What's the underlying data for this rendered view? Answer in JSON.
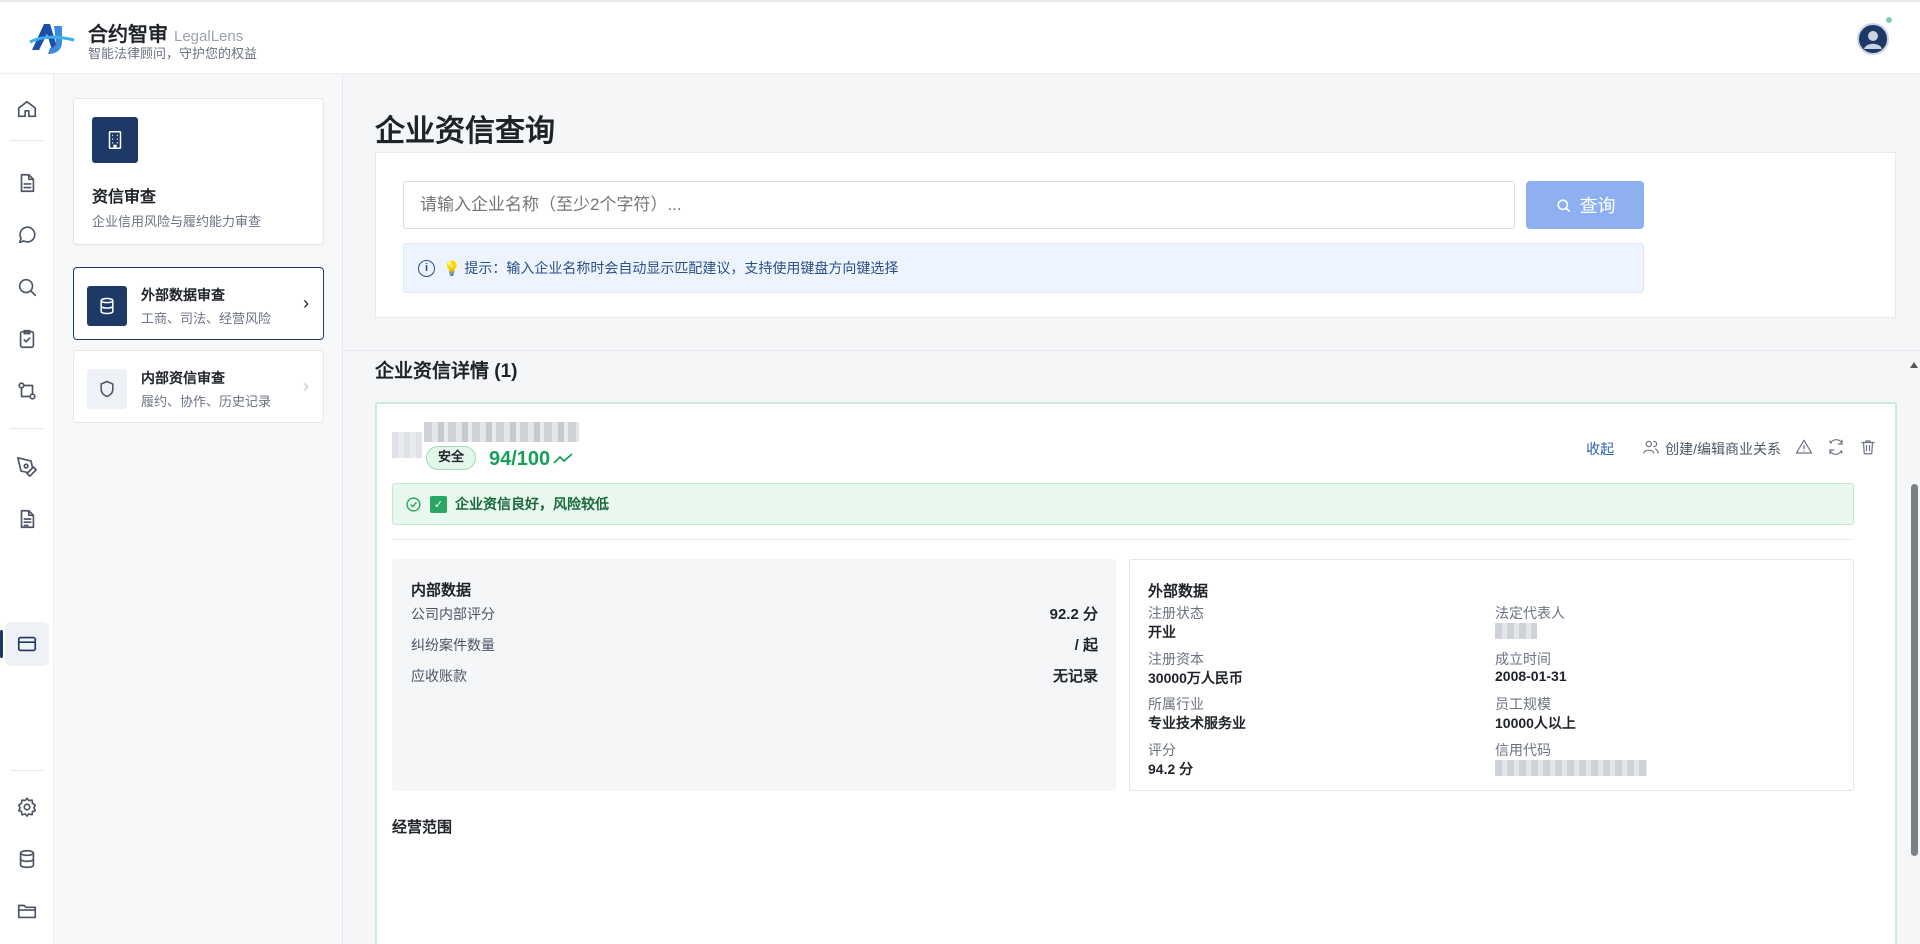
{
  "header": {
    "brand_title": "合约智审",
    "brand_en": "LegalLens",
    "brand_sub": "智能法律顾问，守护您的权益"
  },
  "rail": {
    "icons": [
      "home-icon",
      "document-icon",
      "chat-icon",
      "search-icon",
      "clipboard-check-icon",
      "git-compare-icon",
      "pen-tool-icon",
      "file-text-icon",
      "credit-card-icon",
      "settings-icon",
      "database-icon",
      "folder-icon"
    ],
    "active": "credit-card-icon"
  },
  "sidebar": {
    "card_title": "资信审查",
    "card_sub": "企业信用风险与履约能力审查",
    "items": [
      {
        "title": "外部数据审查",
        "sub": "工商、司法、经营风险",
        "active": true
      },
      {
        "title": "内部资信审查",
        "sub": "履约、协作、历史记录",
        "active": false
      }
    ]
  },
  "main": {
    "page_title": "企业资信查询",
    "search": {
      "placeholder": "请输入企业名称（至少2个字符）...",
      "button_label": "查询"
    },
    "hint": "💡 提示：输入企业名称时会自动显示匹配建议，支持使用键盘方向键选择",
    "section_title": "企业资信详情 (1)"
  },
  "company": {
    "badge": "安全",
    "score": "94/100",
    "actions": {
      "collapse": "收起",
      "relation": "创建/编辑商业关系"
    },
    "status_message": "企业资信良好，风险较低",
    "internal": {
      "title": "内部数据",
      "rows": [
        {
          "label": "公司内部评分",
          "value": "92.2 分"
        },
        {
          "label": "纠纷案件数量",
          "value": "/ 起"
        },
        {
          "label": "应收账款",
          "value": "无记录"
        }
      ]
    },
    "external": {
      "title": "外部数据",
      "reg_status_label": "注册状态",
      "reg_status": "开业",
      "legal_rep_label": "法定代表人",
      "capital_label": "注册资本",
      "capital": "30000万人民币",
      "founded_label": "成立时间",
      "founded": "2008-01-31",
      "industry_label": "所属行业",
      "industry": "专业技术服务业",
      "staff_label": "员工规模",
      "staff": "10000人以上",
      "rating_label": "评分",
      "rating": "94.2 分",
      "credit_code_label": "信用代码"
    },
    "scope_title": "经营范围"
  },
  "colors": {
    "brand": "#1d3a66",
    "safe_green": "#16a05a",
    "search_button": "#8fb0f0",
    "link_blue": "#2b5fb3"
  }
}
